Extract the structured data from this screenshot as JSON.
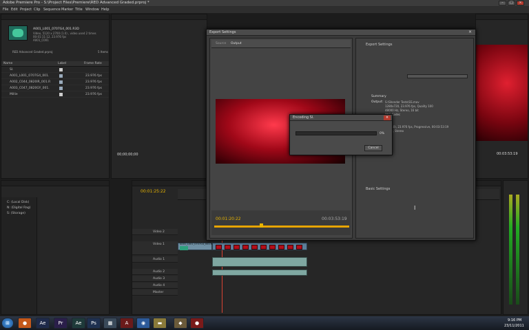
{
  "window": {
    "title": "Adobe Premiere Pro - S:\\Project Files\\Premiere\\RED Advanced Graded.prproj *"
  },
  "menu": [
    "File",
    "Edit",
    "Project",
    "Clip",
    "Sequence",
    "Marker",
    "Title",
    "Window",
    "Help"
  ],
  "project": {
    "clip_name": "A001_L001_0707G4_001.R3D",
    "clip_info1": "Video, 5120 x 2700 (1.0) , video used 2 times",
    "clip_info2": "00:01:11:12, 23.976 fps",
    "clip_info3": "A001_C001",
    "project_file": "RED Advanced Graded.prproj",
    "item_count": "5 Items",
    "columns": {
      "name": "Name",
      "label": "Label",
      "frame_rate": "Frame Rate"
    },
    "items": [
      {
        "name": "Sl.",
        "rate": ""
      },
      {
        "name": "A001_L001_0707G4_001.",
        "rate": "23.976 fps"
      },
      {
        "name": "A002_C044_0820IR_001.R",
        "rate": "23.976 fps"
      },
      {
        "name": "A003_C047_0820GY_001.",
        "rate": "23.976 fps"
      },
      {
        "name": "Millie",
        "rate": "23.976 fps"
      }
    ]
  },
  "source": {
    "timecode": "00;00;00;00"
  },
  "media_browser": {
    "drives": [
      "C: (Local Disk)",
      "N: (Digital Rag)",
      "S: (Storage)"
    ]
  },
  "timeline": {
    "timecode": "00:01:25:22",
    "tracks_video": [
      "Video 2",
      "Video 1"
    ],
    "video1_clip": "A001_L001_0707G4_001.R3D",
    "video2_label": "Video 2",
    "tracks_audio": [
      "Audio 1",
      "Audio 2",
      "Audio 3",
      "Audio 4"
    ],
    "master": "Master",
    "small_clip_label": "A001_C"
  },
  "program": {
    "timecode": "00:03:53:19"
  },
  "export": {
    "title": "Export Settings",
    "source_tab": "Source",
    "output_tab": "Output",
    "timecode_left": "00:01:20:22",
    "timecode_right": "00:03:53:19",
    "section_export": "Export Settings",
    "summary_heading": "Summary",
    "summary_output_label": "Output:",
    "summary_lines": [
      "S:\\Shender Tests\\SS.mov",
      "1280x720, 23.976 fps, Quality 100",
      "48000 Hz, Stereo, 16 bit",
      "PNG Codec",
      "",
      "5...Sl.",
      "20 (1.0), 23.976 fps, Progressive, 00:03:53:19",
      "00 Hz, Stereo"
    ],
    "section_basic": "Basic Settings",
    "cursor": "I"
  },
  "encoding": {
    "title": "Encoding Sl.",
    "progress_percent": 0,
    "progress_text": "0%",
    "cancel": "Cancel"
  },
  "taskbar": {
    "apps": [
      "start",
      "firefox",
      "after-effects",
      "premiere",
      "media-encoder",
      "photoshop",
      "explorer",
      "acrobat",
      "chrome",
      "folder",
      "gimp",
      "recorder"
    ],
    "time": "9:16 PM",
    "date": "23/11/2011"
  }
}
